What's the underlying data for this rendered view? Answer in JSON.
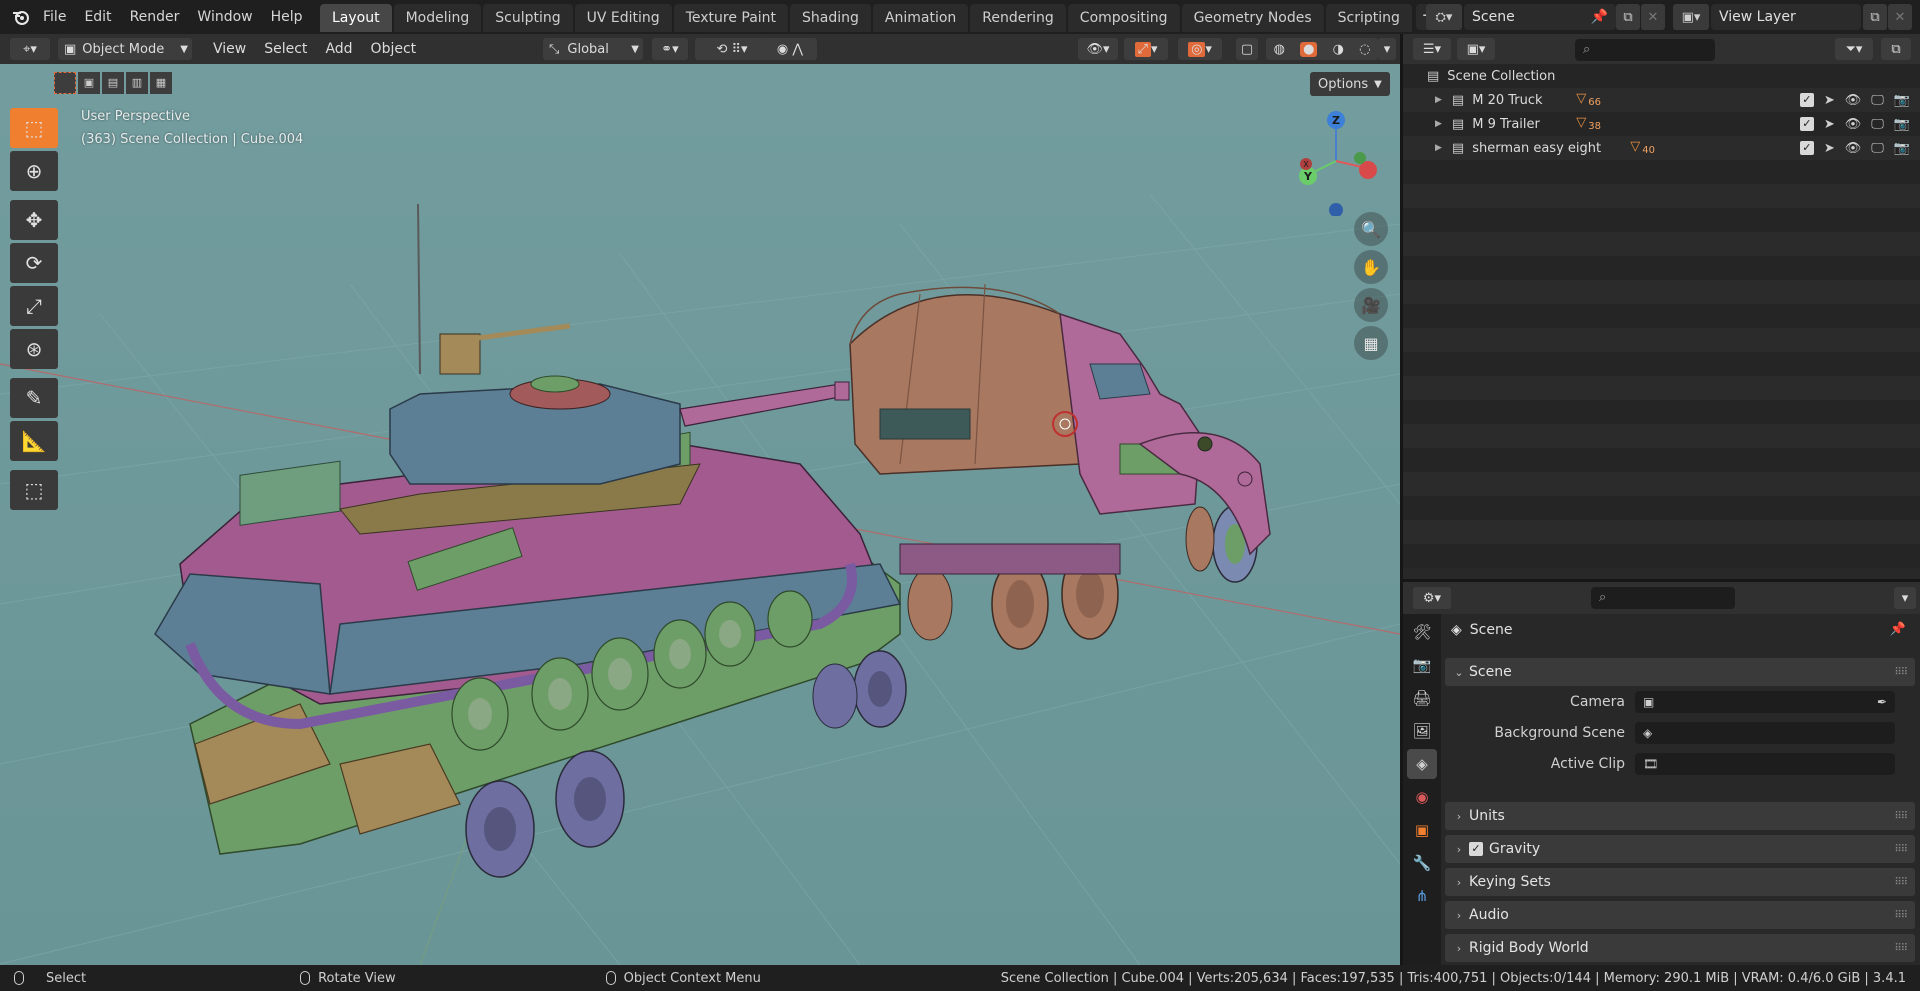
{
  "menubar": {
    "logo_icon": "blender-logo-icon",
    "items": [
      "File",
      "Edit",
      "Render",
      "Window",
      "Help"
    ]
  },
  "workspaces": {
    "tabs": [
      "Layout",
      "Modeling",
      "Sculpting",
      "UV Editing",
      "Texture Paint",
      "Shading",
      "Animation",
      "Rendering",
      "Compositing",
      "Geometry Nodes",
      "Scripting"
    ],
    "active": "Layout",
    "add_label": "+"
  },
  "scene_selector": {
    "value": "Scene"
  },
  "view_layer_selector": {
    "value": "View Layer"
  },
  "viewport_header": {
    "mode": "Object Mode",
    "menus": [
      "View",
      "Select",
      "Add",
      "Object"
    ],
    "transform_orientation": "Global",
    "options_label": "Options"
  },
  "viewport_overlay": {
    "perspective": "User Perspective",
    "context": "(363) Scene Collection | Cube.004"
  },
  "gizmo": {
    "z": "Z",
    "y": "Y",
    "x": "X"
  },
  "toolbar": [
    "select-box",
    "cursor",
    "move",
    "rotate",
    "scale",
    "transform",
    "annotate",
    "measure",
    "add-cube"
  ],
  "outliner": {
    "root": "Scene Collection",
    "collections": [
      {
        "name": "M 20 Truck",
        "count": "66"
      },
      {
        "name": "M 9 Trailer",
        "count": "38"
      },
      {
        "name": "sherman easy eight",
        "count": "40"
      }
    ]
  },
  "properties": {
    "context_title": "Scene",
    "panels": {
      "scene": "Scene",
      "units": "Units",
      "gravity": "Gravity",
      "keying_sets": "Keying Sets",
      "audio": "Audio",
      "rigid_body_world": "Rigid Body World"
    },
    "fields": {
      "camera_label": "Camera",
      "background_scene_label": "Background Scene",
      "active_clip_label": "Active Clip"
    },
    "gravity_checked": true
  },
  "statusbar": {
    "left_select": "Select",
    "rotate_view": "Rotate View",
    "context_menu": "Object Context Menu",
    "stats": "Scene Collection | Cube.004 | Verts:205,634 | Faces:197,535 | Tris:400,751 | Objects:0/144 | Memory: 290.1 MiB | VRAM: 0.4/6.0 GiB | 3.4.1"
  },
  "colors": {
    "viewport_bg": "#6f9a9c",
    "accent_blue": "#4772b3",
    "accent_orange": "#f08030",
    "tank_pink": "#a35a8e",
    "tank_blue": "#5d7f95",
    "trailer_green": "#6e9e68",
    "truck_brown": "#a87860"
  }
}
